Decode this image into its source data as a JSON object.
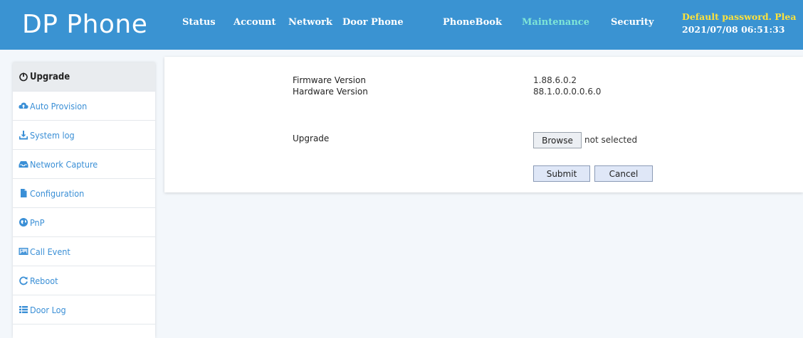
{
  "header": {
    "logo": "DP Phone",
    "nav": [
      {
        "label": "Status"
      },
      {
        "label": "Account"
      },
      {
        "label": "Network"
      },
      {
        "label": "Door Phone"
      },
      {
        "label": "PhoneBook"
      },
      {
        "label": "Maintenance",
        "active": true
      },
      {
        "label": "Security"
      }
    ],
    "notice": "Default password. Plea",
    "datetime": "2021/07/08 06:51:33"
  },
  "sidebar": {
    "items": [
      {
        "label": "Upgrade",
        "icon": "power-icon",
        "active": true
      },
      {
        "label": "Auto Provision",
        "icon": "cloud-upload-icon"
      },
      {
        "label": "System log",
        "icon": "download-icon"
      },
      {
        "label": "Network Capture",
        "icon": "inbox-icon"
      },
      {
        "label": "Configuration",
        "icon": "file-icon"
      },
      {
        "label": "PnP",
        "icon": "globe-icon"
      },
      {
        "label": "Call Event",
        "icon": "picture-icon"
      },
      {
        "label": "Reboot",
        "icon": "refresh-icon"
      },
      {
        "label": "Door Log",
        "icon": "list-icon"
      }
    ]
  },
  "main": {
    "firmware_label": "Firmware Version",
    "firmware_value": "1.88.6.0.2",
    "hardware_label": "Hardware Version",
    "hardware_value": "88.1.0.0.0.0.6.0",
    "upgrade_label": "Upgrade",
    "browse_label": "Browse",
    "file_status": "not selected",
    "submit_label": "Submit",
    "cancel_label": "Cancel"
  },
  "colors": {
    "header_bg": "#3a93d2",
    "active_nav": "#7fe6d7",
    "notice": "#ffe23a",
    "sidebar_link": "#3a8fd6"
  }
}
